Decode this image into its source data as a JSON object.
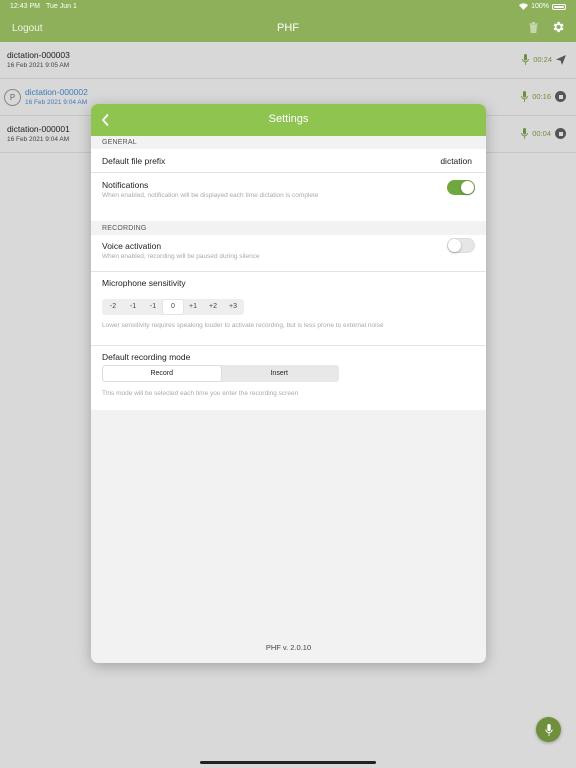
{
  "status_bar": {
    "time": "12:43 PM",
    "date": "Tue Jun 1",
    "battery": "100%"
  },
  "nav": {
    "logout_label": "Logout",
    "title": "PHF",
    "trash_icon": "trash-icon",
    "gear_icon": "gear-icon"
  },
  "recordings": [
    {
      "title": "dictation-000003",
      "date": "16 Feb 2021 9:05 AM",
      "duration": "00:24",
      "action_icon": "send-icon",
      "badge": ""
    },
    {
      "title": "dictation-000002",
      "date": "16 Feb 2021 9:04 AM",
      "duration": "00:16",
      "action_icon": "stop-icon",
      "badge": "P"
    },
    {
      "title": "dictation-000001",
      "date": "16 Feb 2021 9:04 AM",
      "duration": "00:04",
      "action_icon": "stop-icon",
      "badge": ""
    }
  ],
  "settings": {
    "title": "Settings",
    "general": {
      "section_label": "GENERAL",
      "file_prefix_label": "Default file prefix",
      "file_prefix_value": "dictation",
      "notifications_label": "Notifications",
      "notifications_desc": "When enabled, notification will be displayed each time dictation is complete",
      "notifications_on": true
    },
    "recording": {
      "section_label": "RECORDING",
      "voice_activation_label": "Voice activation",
      "voice_activation_desc": "When enabled, recording will be paused during silence",
      "voice_activation_on": false,
      "sensitivity_label": "Microphone sensitivity",
      "sensitivity_options": [
        "-2",
        "-1",
        "-1",
        "0",
        "+1",
        "+2",
        "+3"
      ],
      "sensitivity_selected": "0",
      "sensitivity_desc": "Lower sensitivity requires speaking louder to activate recording, but is less prone to external noise",
      "mode_label": "Default recording mode",
      "mode_options": [
        "Record",
        "Insert"
      ],
      "mode_selected": "Record",
      "mode_desc": "This mode will be selected each time you enter the recording screen"
    },
    "version": "PHF v. 2.0.10"
  },
  "colors": {
    "header_green": "#8fb05a",
    "modal_header_green": "#8fc451",
    "accent_green": "#6ea83e"
  }
}
